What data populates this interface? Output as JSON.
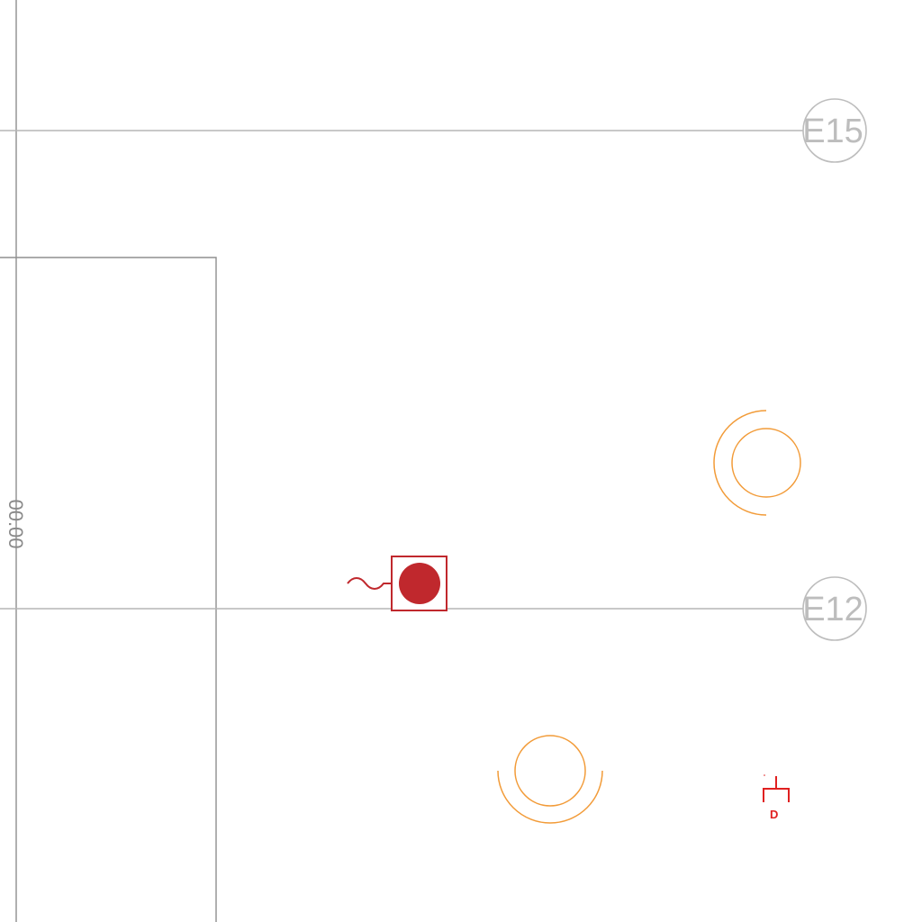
{
  "plan": {
    "gridlines": [
      {
        "label": "E15"
      },
      {
        "label": "E12"
      }
    ],
    "dimension_label": "00.00",
    "symbols": {
      "light_fixtures": [
        "light-fixture",
        "light-fixture"
      ],
      "device": "wall-device",
      "outlet_mark": "D"
    },
    "colors": {
      "grid": "#b5b5b5",
      "wall": "#8f8f8f",
      "fixture": "#f29b38",
      "device": "#c0282d",
      "outlet": "#e02020"
    }
  }
}
